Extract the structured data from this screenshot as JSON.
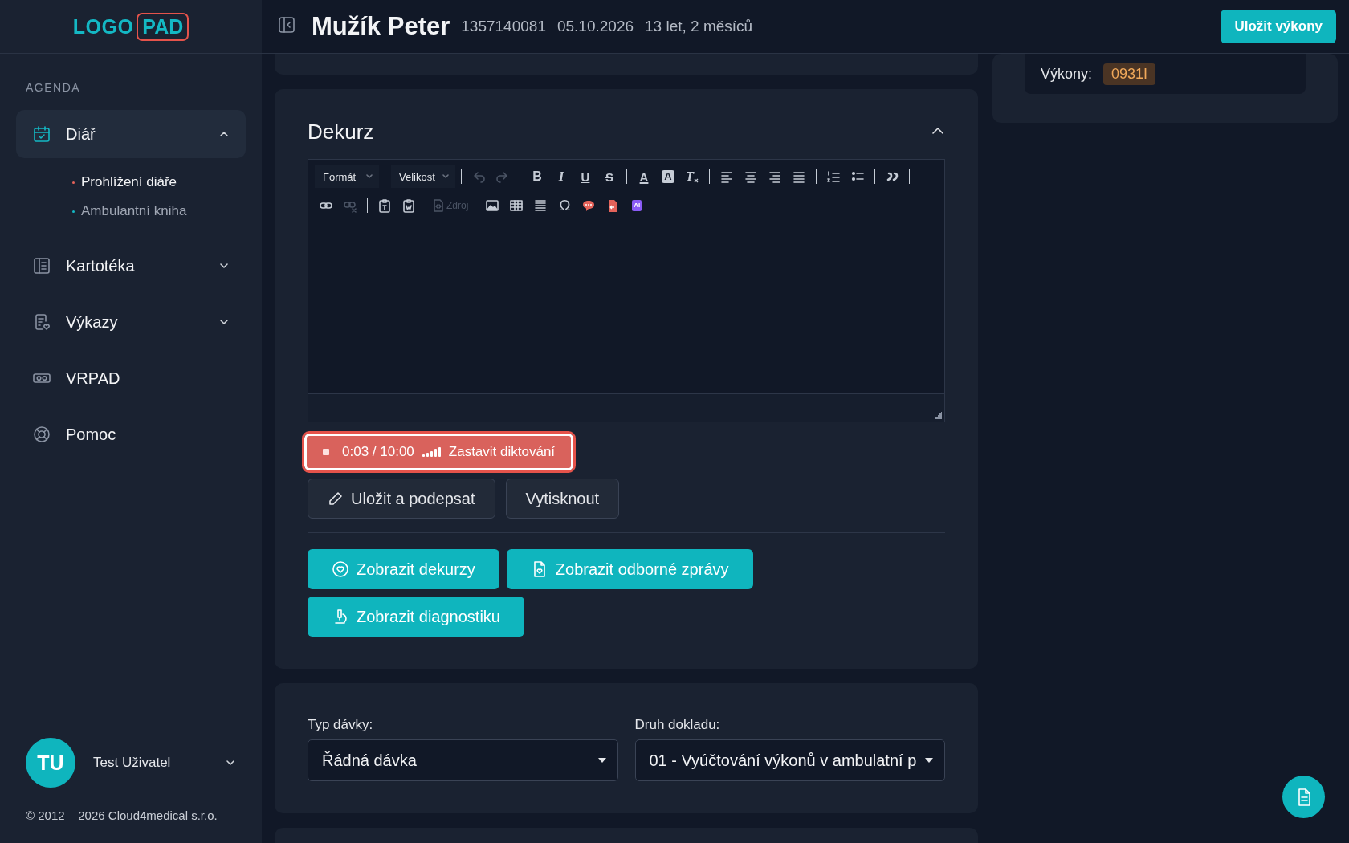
{
  "logo": {
    "part_1": "LOGO",
    "part_2": "PAD"
  },
  "sidebar": {
    "section": "AGENDA",
    "items": [
      {
        "kind": "group",
        "label": "Diář",
        "selected": true,
        "expanded": true,
        "children": [
          {
            "label": "Prohlížení diáře",
            "selected": true
          },
          {
            "label": "Ambulantní kniha",
            "selected": false
          }
        ]
      },
      {
        "kind": "group",
        "label": "Kartotéka",
        "selected": false,
        "expanded": false
      },
      {
        "kind": "group",
        "label": "Výkazy",
        "selected": false,
        "expanded": false
      },
      {
        "kind": "link",
        "label": "VRPAD",
        "selected": false
      },
      {
        "kind": "link",
        "label": "Pomoc",
        "selected": false
      }
    ],
    "user": {
      "initials": "TU",
      "name": "Test Uživatel"
    },
    "copyright": "© 2012 – 2026 Cloud4medical s.r.o."
  },
  "header": {
    "patient_name": "Mužík Peter",
    "patient_id": "1357140081",
    "date": "05.10.2026",
    "age": "13 let, 2 měsíců",
    "save_button": "Uložit výkony"
  },
  "right_panel": {
    "label": "Výkony:",
    "code": "0931I"
  },
  "dekurz": {
    "title": "Dekurz",
    "expanded": true,
    "toolbar": [
      [
        {
          "kind": "select",
          "text": "Formát"
        },
        {
          "kind": "separator"
        },
        {
          "kind": "select",
          "text": "Velikost"
        },
        {
          "kind": "separator"
        },
        {
          "kind": "undo",
          "disabled": true
        },
        {
          "kind": "redo",
          "disabled": true
        },
        {
          "kind": "separator"
        },
        {
          "kind": "bold",
          "text": "B",
          "disabled": false
        },
        {
          "kind": "italic",
          "text": "I",
          "disabled": false
        },
        {
          "kind": "underline",
          "text": "U",
          "disabled": false
        },
        {
          "kind": "strike",
          "text": "S",
          "disabled": false
        },
        {
          "kind": "separator"
        },
        {
          "kind": "textcolor",
          "text": "A",
          "disabled": false
        },
        {
          "kind": "bgcolor",
          "text": "A",
          "disabled": false
        },
        {
          "kind": "clear",
          "text": "T",
          "disabled": false
        },
        {
          "kind": "separator"
        },
        {
          "kind": "alignleft",
          "disabled": false
        },
        {
          "kind": "aligncenter",
          "disabled": false
        },
        {
          "kind": "alignright",
          "disabled": false
        },
        {
          "kind": "justify",
          "disabled": false
        },
        {
          "kind": "separator"
        },
        {
          "kind": "numbered",
          "disabled": false
        },
        {
          "kind": "bullets",
          "disabled": false
        },
        {
          "kind": "separator"
        },
        {
          "kind": "quote",
          "disabled": false
        },
        {
          "kind": "separator"
        }
      ],
      [
        {
          "kind": "link",
          "disabled": false
        },
        {
          "kind": "unlink",
          "disabled": true
        },
        {
          "kind": "separator"
        },
        {
          "kind": "pastetext",
          "disabled": false
        },
        {
          "kind": "pasteword",
          "disabled": false
        },
        {
          "kind": "separator"
        },
        {
          "kind": "source",
          "text": "Zdroj",
          "disabled": true
        },
        {
          "kind": "separator"
        },
        {
          "kind": "image",
          "disabled": false
        },
        {
          "kind": "table",
          "disabled": false
        },
        {
          "kind": "hr",
          "disabled": false
        },
        {
          "kind": "special",
          "text": "Ω",
          "disabled": false
        },
        {
          "kind": "comment",
          "disabled": false
        },
        {
          "kind": "docimport",
          "disabled": false
        },
        {
          "kind": "ai",
          "text": "AI",
          "disabled": false
        }
      ]
    ],
    "dictation": {
      "time": "0:03 / 10:00",
      "button": "Zastavit diktování"
    },
    "actions": [
      "Uložit a podepsat",
      "Vytisknout"
    ],
    "links": [
      "Zobrazit dekurzy",
      "Zobrazit odborné zprávy",
      "Zobrazit diagnostiku"
    ]
  },
  "batch": {
    "fields": [
      {
        "label": "Typ dávky:",
        "value": "Řádná dávka"
      },
      {
        "label": "Druh dokladu:",
        "value": "01 - Vyúčtování výkonů v ambulatní p"
      }
    ]
  }
}
